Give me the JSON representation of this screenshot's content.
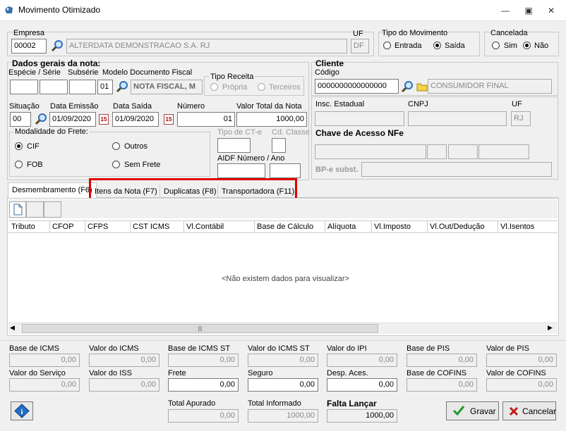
{
  "window": {
    "title": "Movimento Otimizado"
  },
  "empresa": {
    "label": "Empresa",
    "code": "00002",
    "name": "ALTERDATA DEMONSTRACAO S.A. RJ",
    "uf_label": "UF",
    "uf": "DF"
  },
  "tipo_movimento": {
    "label": "Tipo do Movimento",
    "entrada": "Entrada",
    "saida": "Saída"
  },
  "cancelada": {
    "label": "Cancelada",
    "sim": "Sim",
    "nao": "Não"
  },
  "dados_gerais": {
    "label": "Dados gerais da nota:",
    "especie_serie": "Espécie / Série",
    "subserie": "Subsérie",
    "modelo_label": "Modelo Documento Fiscal",
    "modelo_code": "01",
    "modelo_name": "NOTA FISCAL, M",
    "tipo_receita": "Tipo Receita",
    "propria": "Própria",
    "terceiros": "Terceiros",
    "situacao_label": "Situação",
    "situacao": "00",
    "data_emissao_label": "Data Emissão",
    "data_emissao": "01/09/2020",
    "data_saida_label": "Data Saída",
    "data_saida": "01/09/2020",
    "numero_label": "Número",
    "numero": "01",
    "valor_total_label": "Valor Total da Nota",
    "valor_total": "1000,00",
    "modalidade_label": "Modalidade do Frete:",
    "cif": "CIF",
    "outros": "Outros",
    "fob": "FOB",
    "sem_frete": "Sem Frete",
    "tipo_cte": "Tipo de CT-e",
    "cd_classe": "Cd. Classe",
    "aidf": "AIDF Número / Ano"
  },
  "cliente": {
    "label": "Cliente",
    "codigo_label": "Código",
    "codigo": "0000000000000000",
    "nome": "CONSUMIDOR FINAL",
    "insc_label": "Insc. Estadual",
    "cnpj_label": "CNPJ",
    "uf_label": "UF",
    "uf": "RJ",
    "chave_label": "Chave de Acesso NFe",
    "bpe_label": "BP-e subst."
  },
  "tabs": [
    "Desmembramento (F6)",
    "Itens da Nota (F7)",
    "Duplicatas (F8)",
    "Transportadora (F11)"
  ],
  "grid": {
    "columns": [
      "Tributo",
      "CFOP",
      "CFPS",
      "CST ICMS",
      "Vl.Contábil",
      "Base de Cálculo",
      "Alíquota",
      "Vl.Imposto",
      "Vl.Out/Dedução",
      "Vl.Isentos"
    ],
    "empty": "<Não existem dados para visualizar>"
  },
  "totals": {
    "row1": [
      {
        "label": "Base de ICMS",
        "value": "0,00"
      },
      {
        "label": "Valor do ICMS",
        "value": "0,00"
      },
      {
        "label": "Base de ICMS ST",
        "value": "0,00"
      },
      {
        "label": "Valor do ICMS ST",
        "value": "0,00"
      },
      {
        "label": "Valor do IPI",
        "value": "0,00"
      },
      {
        "label": "Base de PIS",
        "value": "0,00"
      },
      {
        "label": "Valor de PIS",
        "value": "0,00"
      }
    ],
    "row2": [
      {
        "label": "Valor do Serviço",
        "value": "0,00"
      },
      {
        "label": "Valor do ISS",
        "value": "0,00"
      },
      {
        "label": "Frete",
        "value": "0,00"
      },
      {
        "label": "Seguro",
        "value": "0,00"
      },
      {
        "label": "Desp. Aces.",
        "value": "0,00"
      },
      {
        "label": "Base de COFINS",
        "value": "0,00"
      },
      {
        "label": "Valor de COFINS",
        "value": "0,00"
      }
    ],
    "total_apurado_label": "Total Apurado",
    "total_apurado": "0,00",
    "total_informado_label": "Total Informado",
    "total_informado": "1000,00",
    "falta_label": "Falta Lançar",
    "falta": "1000,00"
  },
  "buttons": {
    "gravar": "Gravar",
    "cancelar": "Cancelar"
  },
  "colors": {
    "highlight": "#e00000",
    "accent": "#0067c0"
  }
}
